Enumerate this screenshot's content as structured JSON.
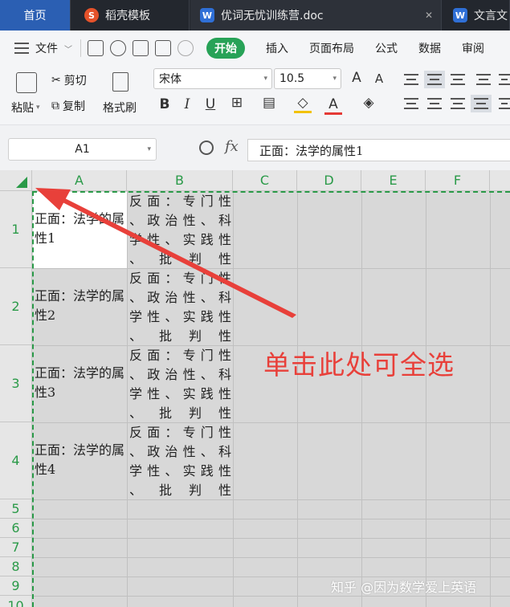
{
  "tabs": {
    "home": "首页",
    "templates": "稻壳模板",
    "document": "优词无忧训练营.doc",
    "partial": "文言文"
  },
  "menu": {
    "file": "文件",
    "items": [
      "开始",
      "插入",
      "页面布局",
      "公式",
      "数据",
      "审阅"
    ],
    "active": "开始"
  },
  "ribbon": {
    "paste": "粘贴",
    "cut": "剪切",
    "copy": "复制",
    "format_painter": "格式刷",
    "font_name": "宋体",
    "font_size": "10.5",
    "bold": "B",
    "italic": "I",
    "underline": "U",
    "grow_font": "A",
    "shrink_font": "A",
    "font_color": "A"
  },
  "formula_bar": {
    "name_box": "A1",
    "fx": "fx",
    "content": "正面：法学的属性1"
  },
  "grid": {
    "columns": [
      "A",
      "B",
      "C",
      "D",
      "E",
      "F"
    ],
    "rows": [
      "1",
      "2",
      "3",
      "4",
      "5",
      "6",
      "7",
      "8",
      "9",
      "10"
    ],
    "cells": [
      {
        "a": "正面：法学的属性1",
        "b": [
          "反面：专门性",
          "、政治性、科",
          "学性、实践性",
          "、批判性"
        ]
      },
      {
        "a": "正面：法学的属性2",
        "b": [
          "反面：专门性",
          "、政治性、科",
          "学性、实践性",
          "、批判性"
        ]
      },
      {
        "a": "正面：法学的属性3",
        "b": [
          "反面：专门性",
          "、政治性、科",
          "学性、实践性",
          "、批判性"
        ]
      },
      {
        "a": "正面：法学的属性4",
        "b": [
          "反面：专门性",
          "、政治性、科",
          "学性、实践性",
          "、批判性"
        ]
      }
    ]
  },
  "annotation": "单击此处可全选",
  "watermark": "知乎 @因为数学爱上英语",
  "colors": {
    "accent_green": "#27a257",
    "annotation_red": "#e8403a",
    "tabbar": "#23272e",
    "home_tab": "#2b5fb3"
  }
}
